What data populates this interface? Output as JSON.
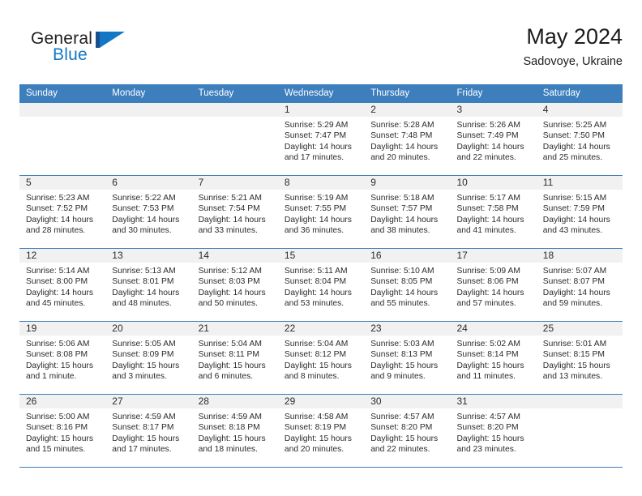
{
  "brand": {
    "name_top": "General",
    "name_bottom": "Blue",
    "mark": "triangle-logo",
    "color_dark": "#231f20",
    "color_blue": "#1277c4"
  },
  "header": {
    "title": "May 2024",
    "subtitle": "Sadovoye, Ukraine"
  },
  "theme": {
    "header_blue": "#3d7ebd",
    "daynum_band": "#f1f1f1",
    "text": "#2b2b2b"
  },
  "weekday_headers": [
    "Sunday",
    "Monday",
    "Tuesday",
    "Wednesday",
    "Thursday",
    "Friday",
    "Saturday"
  ],
  "labels": {
    "sunrise": "Sunrise:",
    "sunset": "Sunset:",
    "daylight": "Daylight:"
  },
  "weeks": [
    [
      {
        "day": "",
        "sunrise": "",
        "sunset": "",
        "daylight_line1": "",
        "daylight_line2": ""
      },
      {
        "day": "",
        "sunrise": "",
        "sunset": "",
        "daylight_line1": "",
        "daylight_line2": ""
      },
      {
        "day": "",
        "sunrise": "",
        "sunset": "",
        "daylight_line1": "",
        "daylight_line2": ""
      },
      {
        "day": "1",
        "sunrise": "Sunrise: 5:29 AM",
        "sunset": "Sunset: 7:47 PM",
        "daylight_line1": "Daylight: 14 hours",
        "daylight_line2": "and 17 minutes."
      },
      {
        "day": "2",
        "sunrise": "Sunrise: 5:28 AM",
        "sunset": "Sunset: 7:48 PM",
        "daylight_line1": "Daylight: 14 hours",
        "daylight_line2": "and 20 minutes."
      },
      {
        "day": "3",
        "sunrise": "Sunrise: 5:26 AM",
        "sunset": "Sunset: 7:49 PM",
        "daylight_line1": "Daylight: 14 hours",
        "daylight_line2": "and 22 minutes."
      },
      {
        "day": "4",
        "sunrise": "Sunrise: 5:25 AM",
        "sunset": "Sunset: 7:50 PM",
        "daylight_line1": "Daylight: 14 hours",
        "daylight_line2": "and 25 minutes."
      }
    ],
    [
      {
        "day": "5",
        "sunrise": "Sunrise: 5:23 AM",
        "sunset": "Sunset: 7:52 PM",
        "daylight_line1": "Daylight: 14 hours",
        "daylight_line2": "and 28 minutes."
      },
      {
        "day": "6",
        "sunrise": "Sunrise: 5:22 AM",
        "sunset": "Sunset: 7:53 PM",
        "daylight_line1": "Daylight: 14 hours",
        "daylight_line2": "and 30 minutes."
      },
      {
        "day": "7",
        "sunrise": "Sunrise: 5:21 AM",
        "sunset": "Sunset: 7:54 PM",
        "daylight_line1": "Daylight: 14 hours",
        "daylight_line2": "and 33 minutes."
      },
      {
        "day": "8",
        "sunrise": "Sunrise: 5:19 AM",
        "sunset": "Sunset: 7:55 PM",
        "daylight_line1": "Daylight: 14 hours",
        "daylight_line2": "and 36 minutes."
      },
      {
        "day": "9",
        "sunrise": "Sunrise: 5:18 AM",
        "sunset": "Sunset: 7:57 PM",
        "daylight_line1": "Daylight: 14 hours",
        "daylight_line2": "and 38 minutes."
      },
      {
        "day": "10",
        "sunrise": "Sunrise: 5:17 AM",
        "sunset": "Sunset: 7:58 PM",
        "daylight_line1": "Daylight: 14 hours",
        "daylight_line2": "and 41 minutes."
      },
      {
        "day": "11",
        "sunrise": "Sunrise: 5:15 AM",
        "sunset": "Sunset: 7:59 PM",
        "daylight_line1": "Daylight: 14 hours",
        "daylight_line2": "and 43 minutes."
      }
    ],
    [
      {
        "day": "12",
        "sunrise": "Sunrise: 5:14 AM",
        "sunset": "Sunset: 8:00 PM",
        "daylight_line1": "Daylight: 14 hours",
        "daylight_line2": "and 45 minutes."
      },
      {
        "day": "13",
        "sunrise": "Sunrise: 5:13 AM",
        "sunset": "Sunset: 8:01 PM",
        "daylight_line1": "Daylight: 14 hours",
        "daylight_line2": "and 48 minutes."
      },
      {
        "day": "14",
        "sunrise": "Sunrise: 5:12 AM",
        "sunset": "Sunset: 8:03 PM",
        "daylight_line1": "Daylight: 14 hours",
        "daylight_line2": "and 50 minutes."
      },
      {
        "day": "15",
        "sunrise": "Sunrise: 5:11 AM",
        "sunset": "Sunset: 8:04 PM",
        "daylight_line1": "Daylight: 14 hours",
        "daylight_line2": "and 53 minutes."
      },
      {
        "day": "16",
        "sunrise": "Sunrise: 5:10 AM",
        "sunset": "Sunset: 8:05 PM",
        "daylight_line1": "Daylight: 14 hours",
        "daylight_line2": "and 55 minutes."
      },
      {
        "day": "17",
        "sunrise": "Sunrise: 5:09 AM",
        "sunset": "Sunset: 8:06 PM",
        "daylight_line1": "Daylight: 14 hours",
        "daylight_line2": "and 57 minutes."
      },
      {
        "day": "18",
        "sunrise": "Sunrise: 5:07 AM",
        "sunset": "Sunset: 8:07 PM",
        "daylight_line1": "Daylight: 14 hours",
        "daylight_line2": "and 59 minutes."
      }
    ],
    [
      {
        "day": "19",
        "sunrise": "Sunrise: 5:06 AM",
        "sunset": "Sunset: 8:08 PM",
        "daylight_line1": "Daylight: 15 hours",
        "daylight_line2": "and 1 minute."
      },
      {
        "day": "20",
        "sunrise": "Sunrise: 5:05 AM",
        "sunset": "Sunset: 8:09 PM",
        "daylight_line1": "Daylight: 15 hours",
        "daylight_line2": "and 3 minutes."
      },
      {
        "day": "21",
        "sunrise": "Sunrise: 5:04 AM",
        "sunset": "Sunset: 8:11 PM",
        "daylight_line1": "Daylight: 15 hours",
        "daylight_line2": "and 6 minutes."
      },
      {
        "day": "22",
        "sunrise": "Sunrise: 5:04 AM",
        "sunset": "Sunset: 8:12 PM",
        "daylight_line1": "Daylight: 15 hours",
        "daylight_line2": "and 8 minutes."
      },
      {
        "day": "23",
        "sunrise": "Sunrise: 5:03 AM",
        "sunset": "Sunset: 8:13 PM",
        "daylight_line1": "Daylight: 15 hours",
        "daylight_line2": "and 9 minutes."
      },
      {
        "day": "24",
        "sunrise": "Sunrise: 5:02 AM",
        "sunset": "Sunset: 8:14 PM",
        "daylight_line1": "Daylight: 15 hours",
        "daylight_line2": "and 11 minutes."
      },
      {
        "day": "25",
        "sunrise": "Sunrise: 5:01 AM",
        "sunset": "Sunset: 8:15 PM",
        "daylight_line1": "Daylight: 15 hours",
        "daylight_line2": "and 13 minutes."
      }
    ],
    [
      {
        "day": "26",
        "sunrise": "Sunrise: 5:00 AM",
        "sunset": "Sunset: 8:16 PM",
        "daylight_line1": "Daylight: 15 hours",
        "daylight_line2": "and 15 minutes."
      },
      {
        "day": "27",
        "sunrise": "Sunrise: 4:59 AM",
        "sunset": "Sunset: 8:17 PM",
        "daylight_line1": "Daylight: 15 hours",
        "daylight_line2": "and 17 minutes."
      },
      {
        "day": "28",
        "sunrise": "Sunrise: 4:59 AM",
        "sunset": "Sunset: 8:18 PM",
        "daylight_line1": "Daylight: 15 hours",
        "daylight_line2": "and 18 minutes."
      },
      {
        "day": "29",
        "sunrise": "Sunrise: 4:58 AM",
        "sunset": "Sunset: 8:19 PM",
        "daylight_line1": "Daylight: 15 hours",
        "daylight_line2": "and 20 minutes."
      },
      {
        "day": "30",
        "sunrise": "Sunrise: 4:57 AM",
        "sunset": "Sunset: 8:20 PM",
        "daylight_line1": "Daylight: 15 hours",
        "daylight_line2": "and 22 minutes."
      },
      {
        "day": "31",
        "sunrise": "Sunrise: 4:57 AM",
        "sunset": "Sunset: 8:20 PM",
        "daylight_line1": "Daylight: 15 hours",
        "daylight_line2": "and 23 minutes."
      },
      {
        "day": "",
        "sunrise": "",
        "sunset": "",
        "daylight_line1": "",
        "daylight_line2": ""
      }
    ]
  ]
}
